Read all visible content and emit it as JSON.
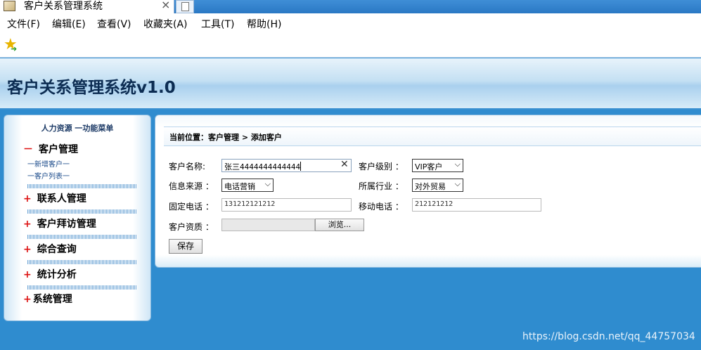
{
  "browser": {
    "tab_title": "客户关系管理系统",
    "tab_close": "×",
    "menu": [
      "文件(F)",
      "编辑(E)",
      "查看(V)",
      "收藏夹(A)",
      "工具(T)",
      "帮助(H)"
    ]
  },
  "app": {
    "title": "客户关系管理系统v1.0"
  },
  "sidebar": {
    "header": "人力资源 一功能菜单",
    "groups": [
      {
        "symbol": "－",
        "label": "客户管理",
        "sub": [
          "一新增客户一",
          "一客户列表一"
        ]
      },
      {
        "symbol": "+",
        "label": "联系人管理"
      },
      {
        "symbol": "+",
        "label": "客户拜访管理"
      },
      {
        "symbol": "+",
        "label": "综合查询"
      },
      {
        "symbol": "+",
        "label": "统计分析"
      },
      {
        "symbol": "+",
        "label": "系统管理"
      }
    ]
  },
  "main": {
    "breadcrumb": "当前位置：客户管理 > 添加客户",
    "form": {
      "name_label": "客户名称:",
      "name_value": "张三4444444444444",
      "level_label": "客户级别 ：",
      "level_value": "VIP客户",
      "source_label": "信息来源 ：",
      "source_value": "电话营销",
      "industry_label": "所属行业 ：",
      "industry_value": "对外贸易",
      "phone_label": "固定电话 ：",
      "phone_value": "131212121212",
      "mobile_label": "移动电话 ：",
      "mobile_value": "212121212",
      "qual_label": "客户资质 ：",
      "browse_label": "浏览...",
      "save_label": "保存"
    }
  },
  "watermark": "https://blog.csdn.net/qq_44757034"
}
